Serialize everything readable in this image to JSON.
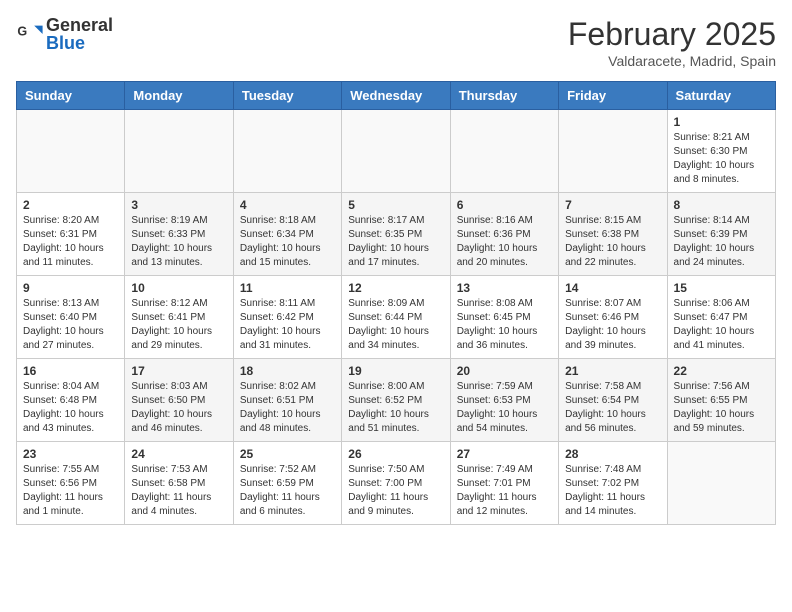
{
  "header": {
    "logo_general": "General",
    "logo_blue": "Blue",
    "month_year": "February 2025",
    "location": "Valdaracete, Madrid, Spain"
  },
  "weekdays": [
    "Sunday",
    "Monday",
    "Tuesday",
    "Wednesday",
    "Thursday",
    "Friday",
    "Saturday"
  ],
  "weeks": [
    [
      {
        "day": "",
        "info": ""
      },
      {
        "day": "",
        "info": ""
      },
      {
        "day": "",
        "info": ""
      },
      {
        "day": "",
        "info": ""
      },
      {
        "day": "",
        "info": ""
      },
      {
        "day": "",
        "info": ""
      },
      {
        "day": "1",
        "info": "Sunrise: 8:21 AM\nSunset: 6:30 PM\nDaylight: 10 hours\nand 8 minutes."
      }
    ],
    [
      {
        "day": "2",
        "info": "Sunrise: 8:20 AM\nSunset: 6:31 PM\nDaylight: 10 hours\nand 11 minutes."
      },
      {
        "day": "3",
        "info": "Sunrise: 8:19 AM\nSunset: 6:33 PM\nDaylight: 10 hours\nand 13 minutes."
      },
      {
        "day": "4",
        "info": "Sunrise: 8:18 AM\nSunset: 6:34 PM\nDaylight: 10 hours\nand 15 minutes."
      },
      {
        "day": "5",
        "info": "Sunrise: 8:17 AM\nSunset: 6:35 PM\nDaylight: 10 hours\nand 17 minutes."
      },
      {
        "day": "6",
        "info": "Sunrise: 8:16 AM\nSunset: 6:36 PM\nDaylight: 10 hours\nand 20 minutes."
      },
      {
        "day": "7",
        "info": "Sunrise: 8:15 AM\nSunset: 6:38 PM\nDaylight: 10 hours\nand 22 minutes."
      },
      {
        "day": "8",
        "info": "Sunrise: 8:14 AM\nSunset: 6:39 PM\nDaylight: 10 hours\nand 24 minutes."
      }
    ],
    [
      {
        "day": "9",
        "info": "Sunrise: 8:13 AM\nSunset: 6:40 PM\nDaylight: 10 hours\nand 27 minutes."
      },
      {
        "day": "10",
        "info": "Sunrise: 8:12 AM\nSunset: 6:41 PM\nDaylight: 10 hours\nand 29 minutes."
      },
      {
        "day": "11",
        "info": "Sunrise: 8:11 AM\nSunset: 6:42 PM\nDaylight: 10 hours\nand 31 minutes."
      },
      {
        "day": "12",
        "info": "Sunrise: 8:09 AM\nSunset: 6:44 PM\nDaylight: 10 hours\nand 34 minutes."
      },
      {
        "day": "13",
        "info": "Sunrise: 8:08 AM\nSunset: 6:45 PM\nDaylight: 10 hours\nand 36 minutes."
      },
      {
        "day": "14",
        "info": "Sunrise: 8:07 AM\nSunset: 6:46 PM\nDaylight: 10 hours\nand 39 minutes."
      },
      {
        "day": "15",
        "info": "Sunrise: 8:06 AM\nSunset: 6:47 PM\nDaylight: 10 hours\nand 41 minutes."
      }
    ],
    [
      {
        "day": "16",
        "info": "Sunrise: 8:04 AM\nSunset: 6:48 PM\nDaylight: 10 hours\nand 43 minutes."
      },
      {
        "day": "17",
        "info": "Sunrise: 8:03 AM\nSunset: 6:50 PM\nDaylight: 10 hours\nand 46 minutes."
      },
      {
        "day": "18",
        "info": "Sunrise: 8:02 AM\nSunset: 6:51 PM\nDaylight: 10 hours\nand 48 minutes."
      },
      {
        "day": "19",
        "info": "Sunrise: 8:00 AM\nSunset: 6:52 PM\nDaylight: 10 hours\nand 51 minutes."
      },
      {
        "day": "20",
        "info": "Sunrise: 7:59 AM\nSunset: 6:53 PM\nDaylight: 10 hours\nand 54 minutes."
      },
      {
        "day": "21",
        "info": "Sunrise: 7:58 AM\nSunset: 6:54 PM\nDaylight: 10 hours\nand 56 minutes."
      },
      {
        "day": "22",
        "info": "Sunrise: 7:56 AM\nSunset: 6:55 PM\nDaylight: 10 hours\nand 59 minutes."
      }
    ],
    [
      {
        "day": "23",
        "info": "Sunrise: 7:55 AM\nSunset: 6:56 PM\nDaylight: 11 hours\nand 1 minute."
      },
      {
        "day": "24",
        "info": "Sunrise: 7:53 AM\nSunset: 6:58 PM\nDaylight: 11 hours\nand 4 minutes."
      },
      {
        "day": "25",
        "info": "Sunrise: 7:52 AM\nSunset: 6:59 PM\nDaylight: 11 hours\nand 6 minutes."
      },
      {
        "day": "26",
        "info": "Sunrise: 7:50 AM\nSunset: 7:00 PM\nDaylight: 11 hours\nand 9 minutes."
      },
      {
        "day": "27",
        "info": "Sunrise: 7:49 AM\nSunset: 7:01 PM\nDaylight: 11 hours\nand 12 minutes."
      },
      {
        "day": "28",
        "info": "Sunrise: 7:48 AM\nSunset: 7:02 PM\nDaylight: 11 hours\nand 14 minutes."
      },
      {
        "day": "",
        "info": ""
      }
    ]
  ]
}
